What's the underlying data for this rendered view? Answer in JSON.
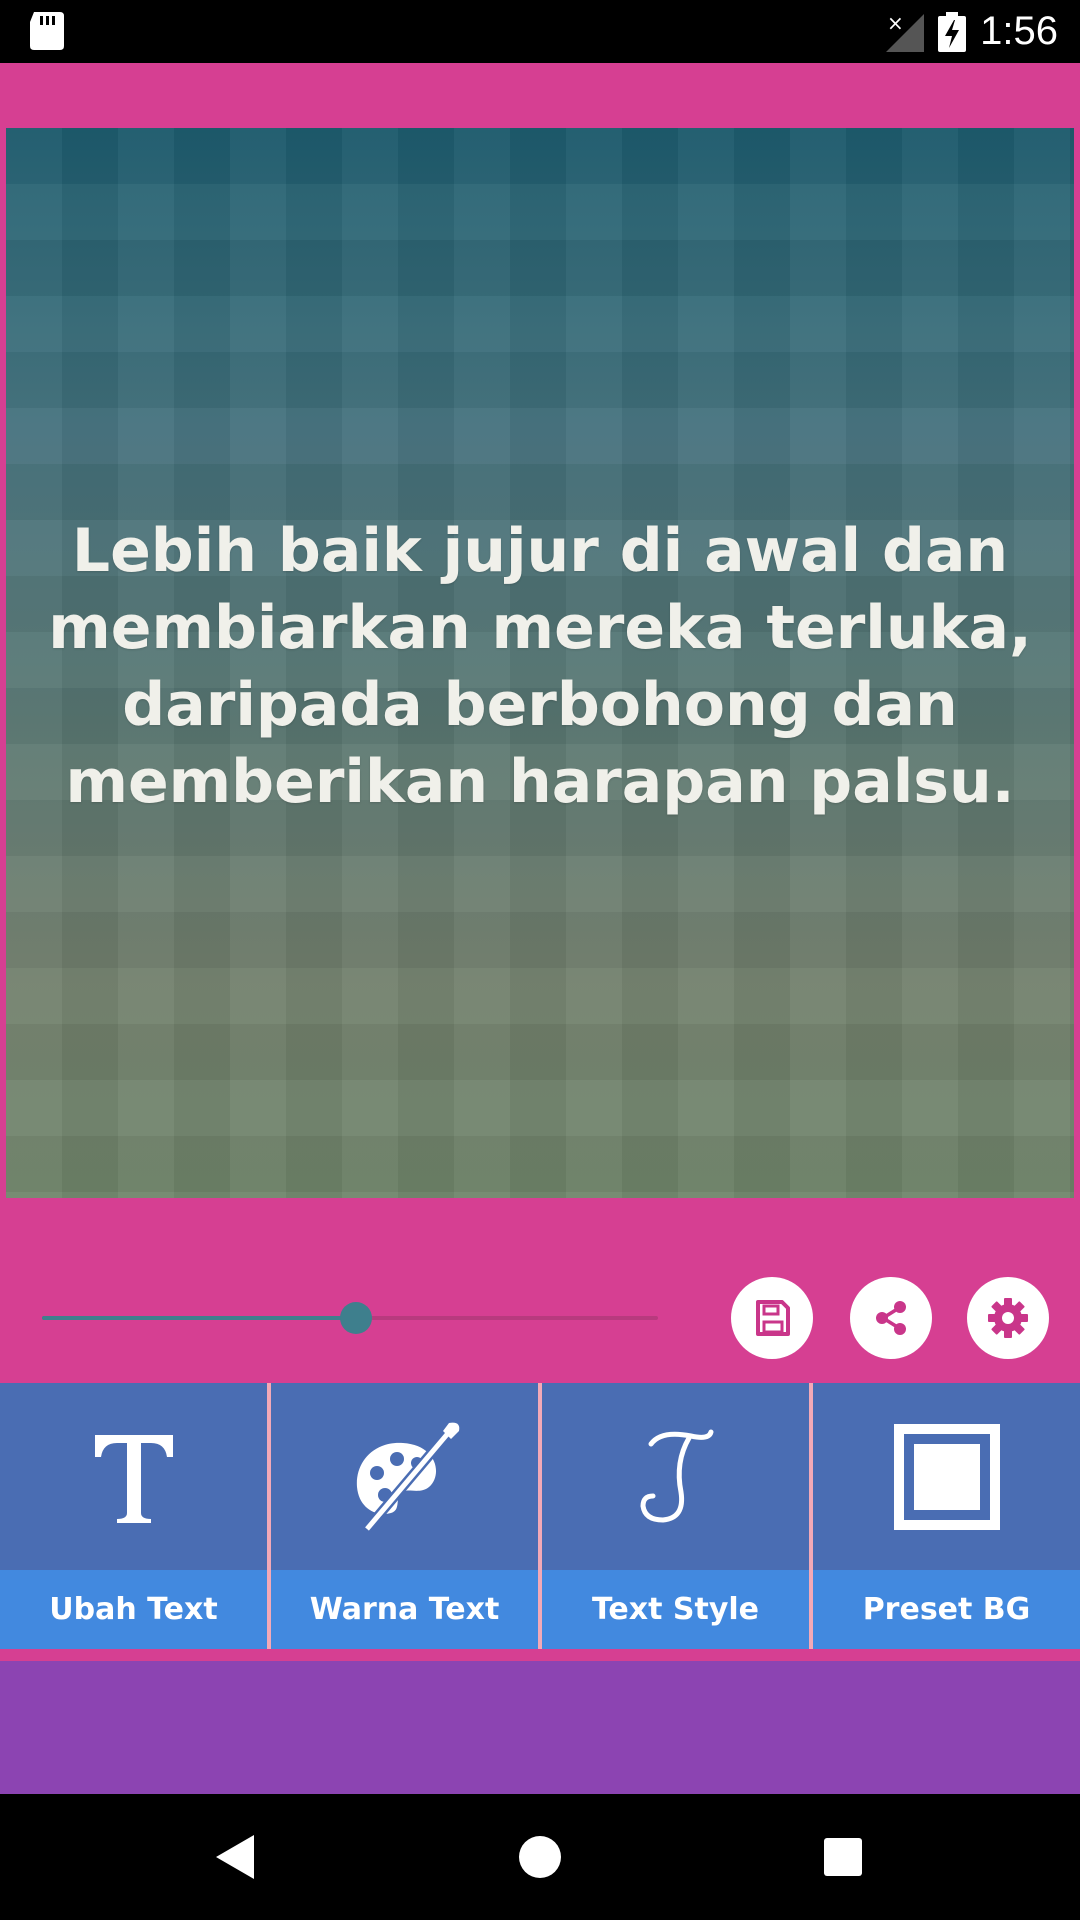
{
  "status_bar": {
    "time": "1:56",
    "icons": [
      "sd-card-icon",
      "signal-no-service-icon",
      "battery-charging-icon"
    ]
  },
  "canvas": {
    "quote": "Lebih baik jujur di awal dan membiarkan mereka terluka, daripada berbohong dan memberikan harapan palsu.",
    "text_color": "#f0f0ea"
  },
  "controls": {
    "slider_value_fraction": 0.51,
    "buttons": [
      {
        "name": "save",
        "icon": "save-icon"
      },
      {
        "name": "share",
        "icon": "share-icon"
      },
      {
        "name": "settings",
        "icon": "gear-icon"
      }
    ]
  },
  "tools": [
    {
      "label": "Ubah Text",
      "icon": "text-t-icon"
    },
    {
      "label": "Warna Text",
      "icon": "palette-icon"
    },
    {
      "label": "Text Style",
      "icon": "script-t-icon"
    },
    {
      "label": "Preset BG",
      "icon": "frame-icon"
    }
  ],
  "navigation": {
    "buttons": [
      "back-icon",
      "home-icon",
      "recents-icon"
    ]
  },
  "colors": {
    "brand_pink": "#d63f92",
    "tool_bg": "#4a6db3",
    "tool_label_bg": "#4289df",
    "purple": "#8c44b2",
    "accent_teal": "#3e7f8d"
  }
}
